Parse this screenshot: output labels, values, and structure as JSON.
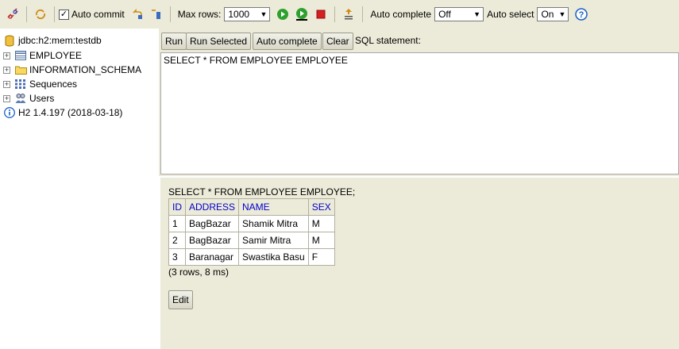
{
  "toolbar": {
    "auto_commit_label": "Auto commit",
    "auto_commit_checked": true,
    "max_rows_label": "Max rows:",
    "max_rows_value": "1000",
    "auto_complete_label": "Auto complete",
    "auto_complete_value": "Off",
    "auto_select_label": "Auto select",
    "auto_select_value": "On",
    "icons": [
      "disconnect-icon",
      "refresh-icon",
      "rollback-icon",
      "commit-icon",
      "run-icon",
      "run-selected-icon",
      "stop-icon",
      "history-icon",
      "help-icon"
    ]
  },
  "tree": {
    "connection": "jdbc:h2:mem:testdb",
    "items": [
      {
        "label": "EMPLOYEE",
        "icon": "table-icon"
      },
      {
        "label": "INFORMATION_SCHEMA",
        "icon": "folder-icon"
      },
      {
        "label": "Sequences",
        "icon": "sequences-icon"
      },
      {
        "label": "Users",
        "icon": "users-icon"
      }
    ],
    "version": "H2 1.4.197 (2018-03-18)"
  },
  "query": {
    "run_label": "Run",
    "run_selected_label": "Run Selected",
    "auto_complete_label": "Auto complete",
    "clear_label": "Clear",
    "sql_statement_label": "SQL statement:",
    "sql_text": "SELECT * FROM EMPLOYEE EMPLOYEE"
  },
  "result": {
    "statement": "SELECT * FROM EMPLOYEE EMPLOYEE;",
    "columns": [
      "ID",
      "ADDRESS",
      "NAME",
      "SEX"
    ],
    "rows": [
      [
        "1",
        "BagBazar",
        "Shamik Mitra",
        "M"
      ],
      [
        "2",
        "BagBazar",
        "Samir Mitra",
        "M"
      ],
      [
        "3",
        "Baranagar",
        "Swastika Basu",
        "F"
      ]
    ],
    "info": "(3 rows, 8 ms)",
    "edit_label": "Edit"
  },
  "colors": {
    "panel_bg": "#ecead8",
    "header_link": "#0000cc",
    "run_green": "#2ea02e",
    "stop_red": "#d42020",
    "help_blue": "#1a5fc8"
  }
}
